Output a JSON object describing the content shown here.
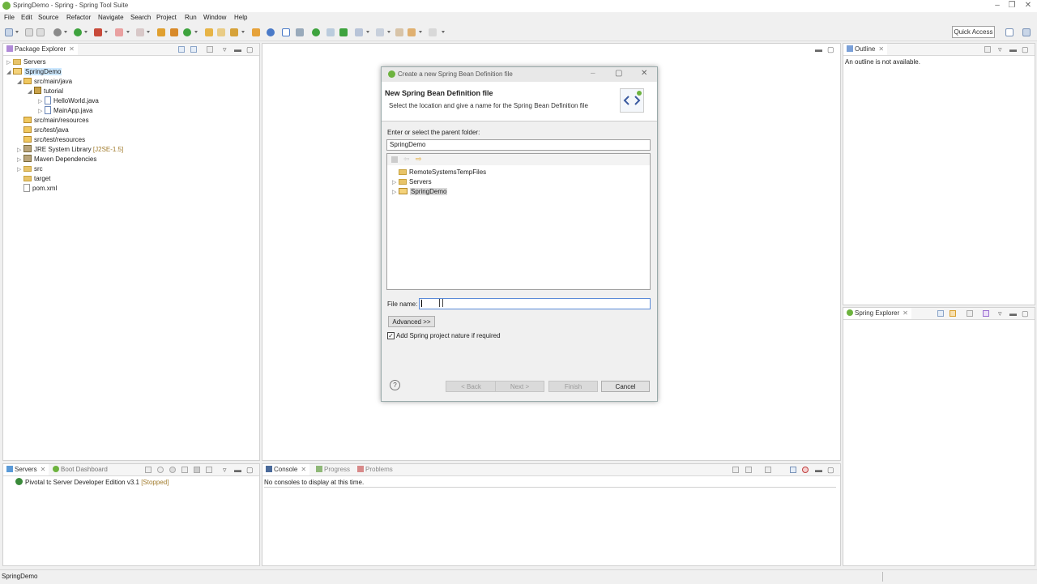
{
  "window": {
    "title": "SpringDemo - Spring - Spring Tool Suite",
    "controls": [
      "–",
      "❐",
      "✕"
    ]
  },
  "menu": [
    "File",
    "Edit",
    "Source",
    "Refactor",
    "Navigate",
    "Search",
    "Project",
    "Run",
    "Window",
    "Help"
  ],
  "toolbar": {
    "quick_access": "Quick Access"
  },
  "package_explorer": {
    "tab": "Package Explorer",
    "items": [
      {
        "label": "Servers"
      },
      {
        "label": "SpringDemo"
      },
      {
        "label": "src/main/java"
      },
      {
        "label": "tutorial"
      },
      {
        "label": "HelloWorld.java"
      },
      {
        "label": "MainApp.java"
      },
      {
        "label": "src/main/resources"
      },
      {
        "label": "src/test/java"
      },
      {
        "label": "src/test/resources"
      },
      {
        "label": "JRE System Library",
        "suffix": "[J2SE-1.5]"
      },
      {
        "label": "Maven Dependencies"
      },
      {
        "label": "src"
      },
      {
        "label": "target"
      },
      {
        "label": "pom.xml"
      }
    ]
  },
  "outline": {
    "tab": "Outline",
    "message": "An outline is not available."
  },
  "spring_explorer": {
    "tab": "Spring Explorer"
  },
  "servers_panel": {
    "tabs": [
      "Servers",
      "Boot Dashboard"
    ],
    "server_name": "Pivotal tc Server Developer Edition v3.1",
    "server_status": "[Stopped]"
  },
  "console_panel": {
    "tabs": [
      "Console",
      "Progress",
      "Problems"
    ],
    "message": "No consoles to display at this time."
  },
  "dialog": {
    "title": "Create a new Spring Bean Definition file",
    "heading": "New Spring Bean Definition file",
    "description": "Select the location and give a name for the Spring Bean Definition file",
    "parent_label": "Enter or select the parent folder:",
    "parent_value": "SpringDemo",
    "tree": [
      "RemoteSystemsTempFiles",
      "Servers",
      "SpringDemo"
    ],
    "filename_label": "File name:",
    "filename_value": "",
    "advanced_button": "Advanced >>",
    "checkbox_label": "Add Spring project nature if required",
    "checkbox_checked": true,
    "buttons": {
      "back": "< Back",
      "next": "Next >",
      "finish": "Finish",
      "cancel": "Cancel"
    }
  },
  "status_bar": {
    "text": "SpringDemo"
  },
  "colors": {
    "accent": "#6db33f",
    "selection": "#cce8ff",
    "stopped": "#a07a2a"
  }
}
